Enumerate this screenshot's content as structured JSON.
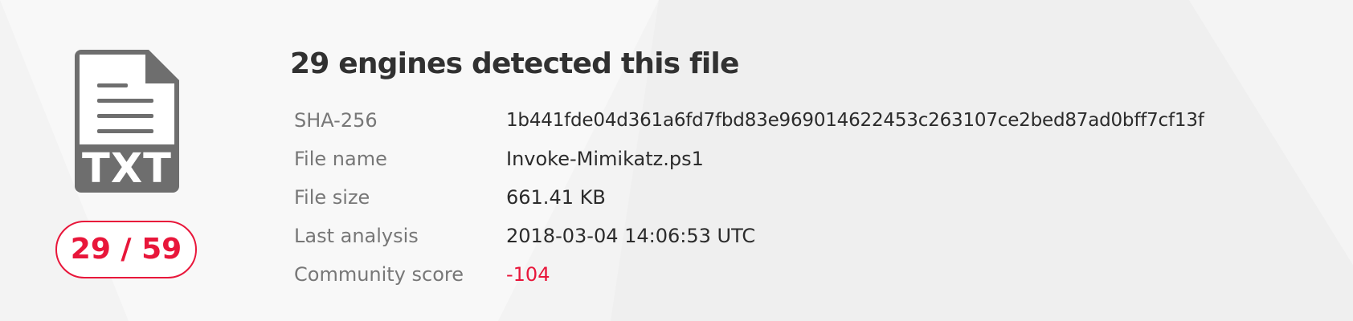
{
  "file": {
    "type_label": "TXT",
    "icon": "txt-file-icon"
  },
  "detection": {
    "ratio": "29 / 59",
    "headline": "29 engines detected this file"
  },
  "details": [
    {
      "label": "SHA-256",
      "value": "1b441fde04d361a6fd7fbd83e969014622453c263107ce2bed87ad0bff7cf13f"
    },
    {
      "label": "File name",
      "value": "Invoke-Mimikatz.ps1"
    },
    {
      "label": "File size",
      "value": "661.41 KB"
    },
    {
      "label": "Last analysis",
      "value": "2018-03-04 14:06:53 UTC"
    },
    {
      "label": "Community score",
      "value": "-104"
    }
  ],
  "colors": {
    "alert": "#e8163a",
    "icon_gray": "#6e6e6e",
    "label_gray": "#777777",
    "text_dark": "#2b2b2b"
  }
}
